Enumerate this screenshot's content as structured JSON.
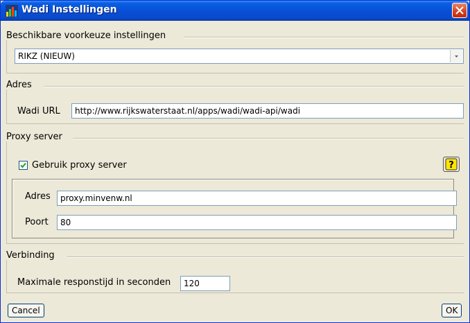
{
  "window": {
    "title": "Wadi Instellingen"
  },
  "presets": {
    "legend": "Beschikbare voorkeuze instellingen",
    "selected": "RIKZ (NIEUW)"
  },
  "address": {
    "legend": "Adres",
    "url_label": "Wadi URL",
    "url_value": "http://www.rijkswaterstaat.nl/apps/wadi/wadi-api/wadi"
  },
  "proxy": {
    "legend": "Proxy server",
    "use_proxy_label": "Gebruik proxy server",
    "use_proxy_checked": true,
    "help_icon": "question-mark-icon",
    "host_label": "Adres",
    "host_value": "proxy.minvenw.nl",
    "port_label": "Poort",
    "port_value": "80"
  },
  "connection": {
    "legend": "Verbinding",
    "timeout_label": "Maximale responstijd in seconden",
    "timeout_value": "120"
  },
  "buttons": {
    "cancel": "Cancel",
    "ok": "OK"
  },
  "colors": {
    "titlebar": "#0a5fe0",
    "dialog_bg": "#ece9d8",
    "close_button": "#d4411e"
  }
}
